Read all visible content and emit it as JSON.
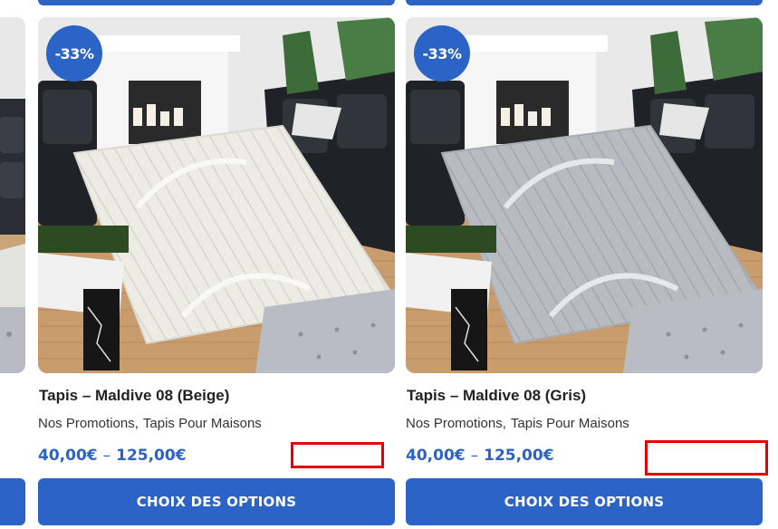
{
  "products": [
    {
      "title": "Tapis – Maldive 08 (Beige)",
      "badge": "-33%",
      "categories": [
        "Nos Promotions",
        "Tapis Pour Maisons"
      ],
      "price_min": "40,00€",
      "price_sep": "–",
      "price_max": "125,00€",
      "button_label": "CHOIX DES OPTIONS",
      "rug_color": "#ecebe4",
      "image_alt": "Tapis beige"
    },
    {
      "title": "Tapis – Maldive 08 (Gris)",
      "badge": "-33%",
      "categories": [
        "Nos Promotions",
        "Tapis Pour Maisons"
      ],
      "price_min": "40,00€",
      "price_sep": "–",
      "price_max": "125,00€",
      "button_label": "CHOIX DES OPTIONS",
      "rug_color": "#b8bcc0",
      "image_alt": "Tapis gris"
    }
  ],
  "colors": {
    "accent": "#2b63c6",
    "highlight": "#e60000"
  }
}
